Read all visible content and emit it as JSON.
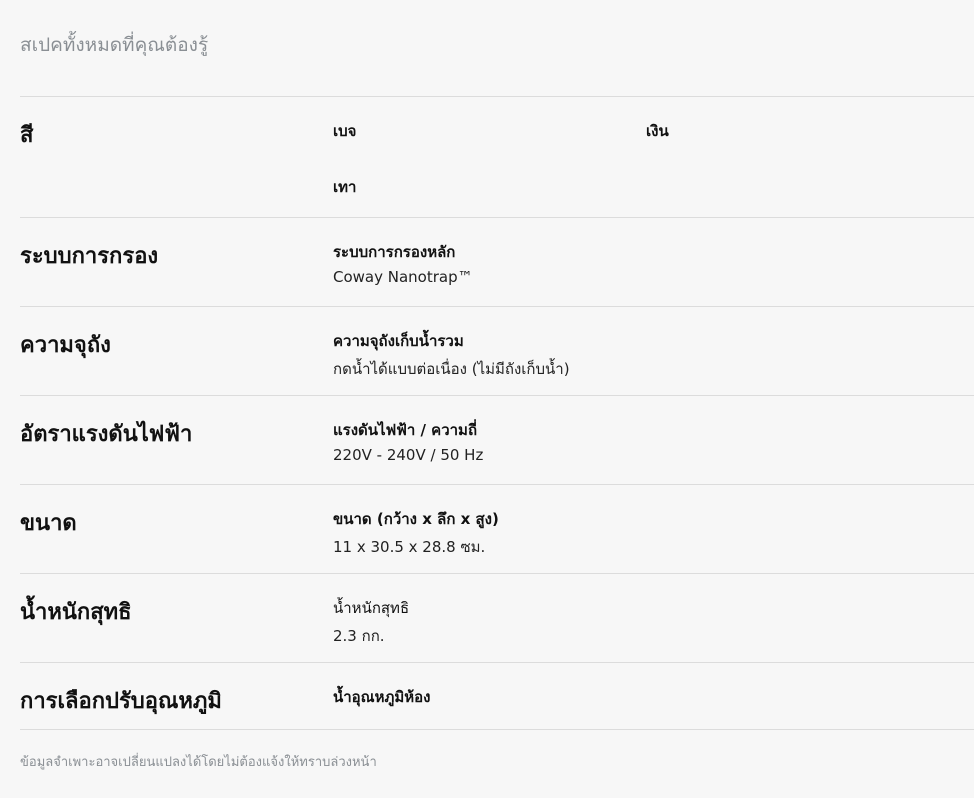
{
  "heading": "สเปคทั้งหมดที่คุณต้องรู้",
  "specs": [
    {
      "label": "สี",
      "options": [
        "เบจ",
        "เงิน",
        "เทา"
      ]
    },
    {
      "label": "ระบบการกรอง",
      "title": "ระบบการกรองหลัก",
      "value": "Coway Nanotrap™"
    },
    {
      "label": "ความจุถัง",
      "title": "ความจุถังเก็บน้ำรวม",
      "value": "กดน้ำได้แบบต่อเนื่อง (ไม่มีถังเก็บน้ำ)"
    },
    {
      "label": "อัตราแรงดันไฟฟ้า",
      "title": "แรงดันไฟฟ้า / ความถี่",
      "value": "220V - 240V / 50 Hz"
    },
    {
      "label": "ขนาด",
      "title": "ขนาด (กว้าง x ลึก x สูง)",
      "value": "11 x 30.5 x 28.8 ซม."
    },
    {
      "label": "น้ำหนักสุทธิ",
      "title": "น้ำหนักสุทธิ",
      "value": "2.3 กก."
    },
    {
      "label": "การเลือกปรับอุณหภูมิ",
      "title": "น้ำอุณหภูมิห้อง"
    }
  ],
  "footnote": "ข้อมูลจำเพาะอาจเปลี่ยนแปลงได้โดยไม่ต้องแจ้งให้ทราบล่วงหน้า"
}
